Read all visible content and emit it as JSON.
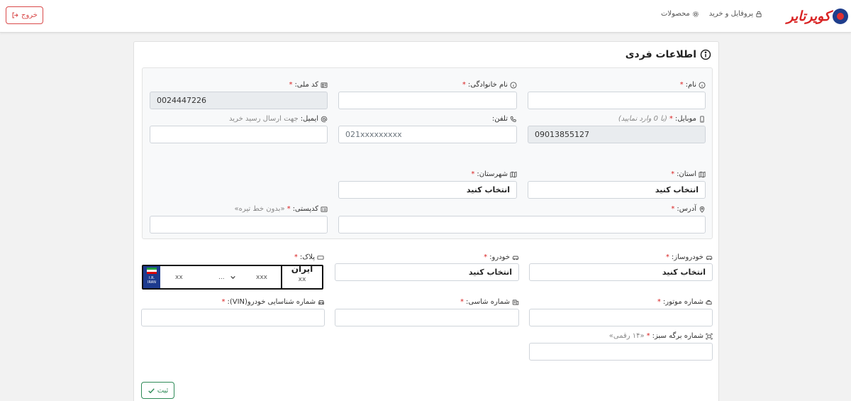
{
  "header": {
    "brand": "کویرتایر",
    "nav": [
      {
        "label": "پروفایل و خرید",
        "icon": "lock-icon"
      },
      {
        "label": "محصولات",
        "icon": "gear-icon"
      }
    ],
    "logout_label": "خروج"
  },
  "form": {
    "title": "اطلاعات فردی",
    "first_name": {
      "label": "نام:",
      "required": "*",
      "value": ""
    },
    "last_name": {
      "label": "نام خانوادگی:",
      "required": "*",
      "value": ""
    },
    "national_code": {
      "label": "کد ملی:",
      "required": "*",
      "value": "0024447226"
    },
    "mobile": {
      "label": "موبایل:",
      "required": "*",
      "hint": "(با 0 وارد نمایید)",
      "value": "09013855127"
    },
    "phone": {
      "label": "تلفن:",
      "placeholder": "021xxxxxxxxx"
    },
    "email": {
      "label": "ایمیل:",
      "hint": "جهت ارسال رسید خرید",
      "value": ""
    },
    "province": {
      "label": "استان:",
      "required": "*",
      "value": "انتخاب کنید"
    },
    "city": {
      "label": "شهرستان:",
      "required": "*",
      "value": "انتخاب کنید"
    },
    "address": {
      "label": "آدرس:",
      "required": "*",
      "value": ""
    },
    "postal_code": {
      "label": "کدپستی:",
      "required": "*",
      "hint": "«بدون خط تیره»",
      "value": ""
    },
    "manufacturer": {
      "label": "خودروساز:",
      "required": "*",
      "value": "انتخاب کنید"
    },
    "car": {
      "label": "خودرو:",
      "required": "*",
      "value": "انتخاب کنید"
    },
    "plate": {
      "label": "پلاک:",
      "required": "*",
      "flag_text_1": "I.R.",
      "flag_text_2": "IRAN",
      "part1": "xx",
      "letter": "...",
      "part3": "xxx",
      "iran_word": "ایران",
      "iran_code": "xx"
    },
    "engine_number": {
      "label": "شماره موتور:",
      "required": "*",
      "value": ""
    },
    "chassis_number": {
      "label": "شماره شاسی:",
      "required": "*",
      "value": ""
    },
    "vin": {
      "label": "شماره شناسایی خودرو(VIN):",
      "required": "*",
      "value": ""
    },
    "green_card": {
      "label": "شماره برگه سبز:",
      "required": "*",
      "hint": "«۱۴ رقمی»",
      "value": ""
    },
    "submit_label": "ثبت"
  },
  "colors": {
    "accent_red": "#d92323",
    "brand_blue": "#1f3e8c",
    "submit_green": "#2e8b57"
  }
}
